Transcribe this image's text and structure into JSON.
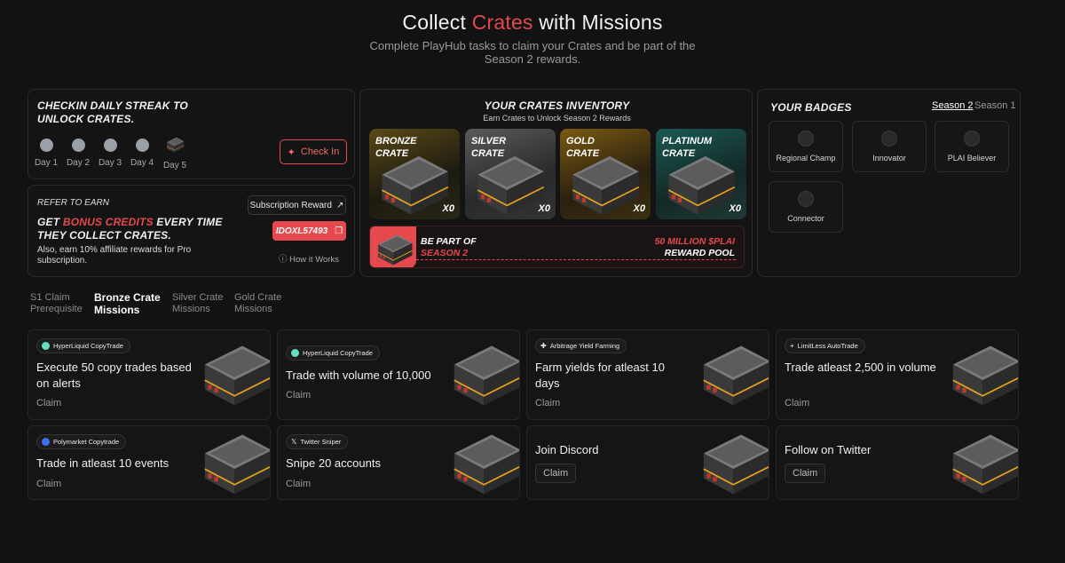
{
  "header": {
    "title_pre": "Collect",
    "title_accent": "Crates",
    "title_post": "with Missions",
    "subtitle": "Complete PlayHub tasks to claim your Crates and be part of the Season 2 rewards."
  },
  "checkin": {
    "title": "CHECKIN DAILY STREAK TO UNLOCK CRATES.",
    "days": [
      "Day 1",
      "Day 2",
      "Day 3",
      "Day 4",
      "Day 5"
    ],
    "button": "Check In"
  },
  "refer": {
    "label": "REFER TO EARN",
    "heading_pre": "GET",
    "heading_accent": "BONUS CREDITS",
    "heading_post": "EVERY TIME THEY COLLECT CRATES.",
    "desc": "Also, earn 10% affiliate rewards for Pro subscription.",
    "subscription_button": "Subscription Reward",
    "code": "IDOXL57493",
    "how": "How it Works"
  },
  "inventory": {
    "title": "YOUR CRATES INVENTORY",
    "subtitle": "Earn Crates to Unlock Season 2 Rewards",
    "crates": [
      {
        "name_1": "BRONZE",
        "name_2": "CRATE",
        "count": "X0",
        "color": "#c8a24a"
      },
      {
        "name_1": "SILVER",
        "name_2": "CRATE",
        "count": "X0",
        "color": "#e8a0a8"
      },
      {
        "name_1": "GOLD",
        "name_2": "CRATE",
        "count": "X0",
        "color": "#f0b030"
      },
      {
        "name_1": "PLATINUM",
        "name_2": "CRATE",
        "count": "X0",
        "color": "#60d8d0"
      }
    ],
    "banner": {
      "left_1": "BE PART OF",
      "left_2": "SEASON 2",
      "right_1": "50 MILLION $PLAI",
      "right_2": "REWARD POOL"
    }
  },
  "badges": {
    "title": "YOUR BADGES",
    "tab_active": "Season 2",
    "tab_inactive": "Season 1",
    "items": [
      "Regional Champ",
      "Innovator",
      "PLAI Believer",
      "Connector"
    ]
  },
  "tabs": [
    {
      "line1": "S1 Claim",
      "line2": "Prerequisite"
    },
    {
      "line1": "Bronze Crate",
      "line2": "Missions"
    },
    {
      "line1": "Silver Crate",
      "line2": "Missions"
    },
    {
      "line1": "Gold Crate",
      "line2": "Missions"
    }
  ],
  "missions": [
    {
      "tag": "HyperLiquid CopyTrade",
      "title": "Execute 50 copy trades based on alerts",
      "claim": "Claim"
    },
    {
      "tag": "HyperLiquid CopyTrade",
      "title": "Trade with volume of 10,000",
      "claim": "Claim"
    },
    {
      "tag": "Arbitrage Yield Farming",
      "title": "Farm yields for atleast 10 days",
      "claim": "Claim"
    },
    {
      "tag": "LimitLess AutoTrade",
      "title": "Trade atleast 2,500 in volume",
      "claim": "Claim"
    },
    {
      "tag": "Polymarket Copytrade",
      "title": "Trade in atleast 10 events",
      "claim": "Claim"
    },
    {
      "tag": "Twitter Sniper",
      "title": "Snipe 20 accounts",
      "claim": "Claim"
    },
    {
      "tag": "",
      "title": "Join Discord",
      "claim": "Claim"
    },
    {
      "tag": "",
      "title": "Follow on Twitter",
      "claim": "Claim"
    }
  ]
}
